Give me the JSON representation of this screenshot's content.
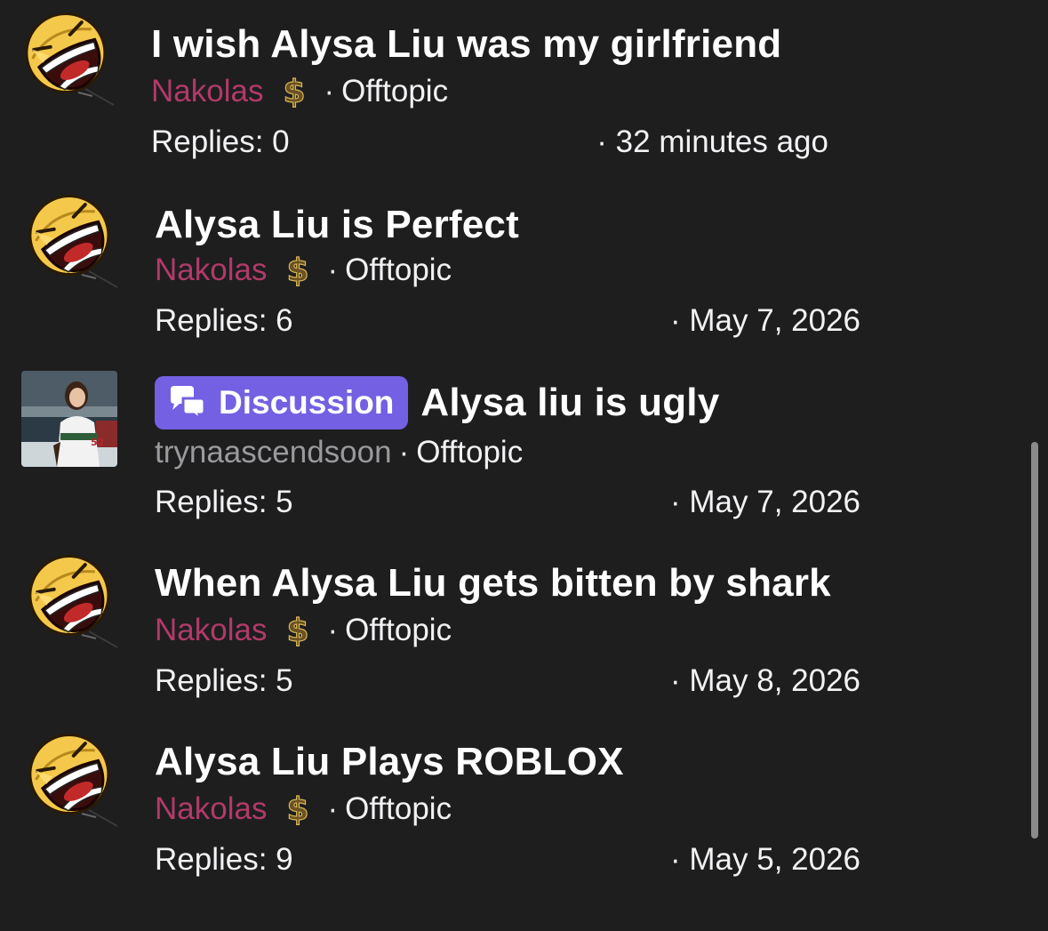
{
  "threads": [
    {
      "title": "I wish Alysa Liu was my girlfriend",
      "author": "Nakolas",
      "has_dollar_badge": true,
      "separator": "·",
      "category": "Offtopic",
      "replies": "Replies: 0",
      "date": "· 32 minutes ago",
      "avatar": "laughing-emoji-icon"
    },
    {
      "title": "Alysa Liu is Perfect",
      "author": "Nakolas",
      "has_dollar_badge": true,
      "separator": "·",
      "category": "Offtopic",
      "replies": "Replies: 6",
      "date": "· May 7, 2026",
      "avatar": "laughing-emoji-icon"
    },
    {
      "badge": "Discussion",
      "title": "Alysa liu is ugly",
      "author": "trynaascendsoon",
      "has_dollar_badge": false,
      "separator": "·",
      "category": "Offtopic",
      "replies": "Replies: 5",
      "date": "· May 7, 2026",
      "avatar": "photo-avatar"
    },
    {
      "title": "When Alysa Liu gets bitten by shark",
      "author": "Nakolas",
      "has_dollar_badge": true,
      "separator": "·",
      "category": "Offtopic",
      "replies": "Replies: 5",
      "date": "· May 8, 2026",
      "avatar": "laughing-emoji-icon"
    },
    {
      "title": "Alysa Liu Plays ROBLOX",
      "author": "Nakolas",
      "has_dollar_badge": true,
      "separator": "·",
      "category": "Offtopic",
      "replies": "Replies: 9",
      "date": "· May 5, 2026",
      "avatar": "laughing-emoji-icon"
    }
  ],
  "colors": {
    "background": "#1e1e1f",
    "author": "#b13a68",
    "badge": "#7360e2",
    "muted_author": "#9a9a9e"
  }
}
